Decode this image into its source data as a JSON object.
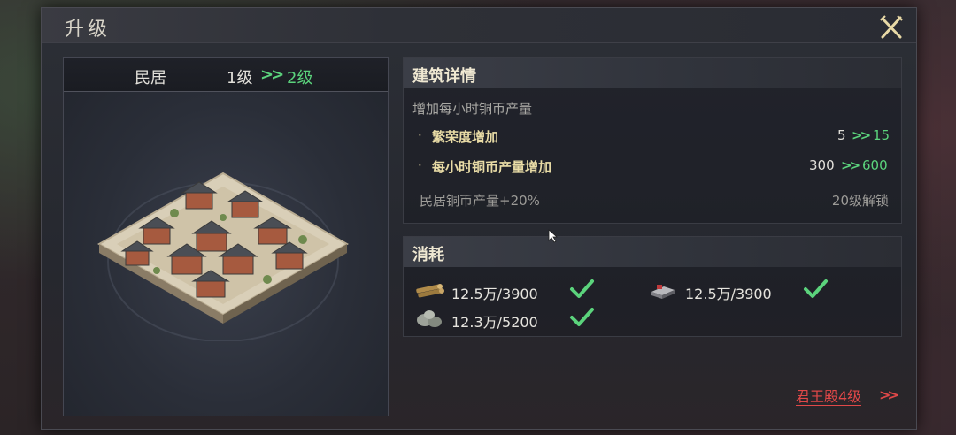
{
  "dialog": {
    "title": "升级"
  },
  "building": {
    "name": "民居",
    "level_from": "1级",
    "level_arrow": ">>",
    "level_to": "2级"
  },
  "details": {
    "title": "建筑详情",
    "description": "增加每小时铜币产量",
    "rows": [
      {
        "bullet": "·",
        "label": "繁荣度增加",
        "from": "5",
        "arrow": ">>",
        "to": "15"
      },
      {
        "bullet": "·",
        "label": "每小时铜币产量增加",
        "from": "300",
        "arrow": ">>",
        "to": "600"
      }
    ],
    "locked": {
      "label": "民居铜币产量+20%",
      "note": "20级解锁"
    }
  },
  "cost": {
    "title": "消耗",
    "resources": [
      {
        "icon": "wood-icon",
        "value": "12.5万/3900",
        "met": true
      },
      {
        "icon": "iron-icon",
        "value": "12.5万/3900",
        "met": true
      },
      {
        "icon": "stone-icon",
        "value": "12.3万/5200",
        "met": true
      }
    ]
  },
  "requirement": {
    "text": "君王殿4级",
    "arrow": ">>"
  },
  "colors": {
    "accent_green": "#5bd37c",
    "warning_red": "#e04848",
    "gold_text": "#e9dca6"
  }
}
